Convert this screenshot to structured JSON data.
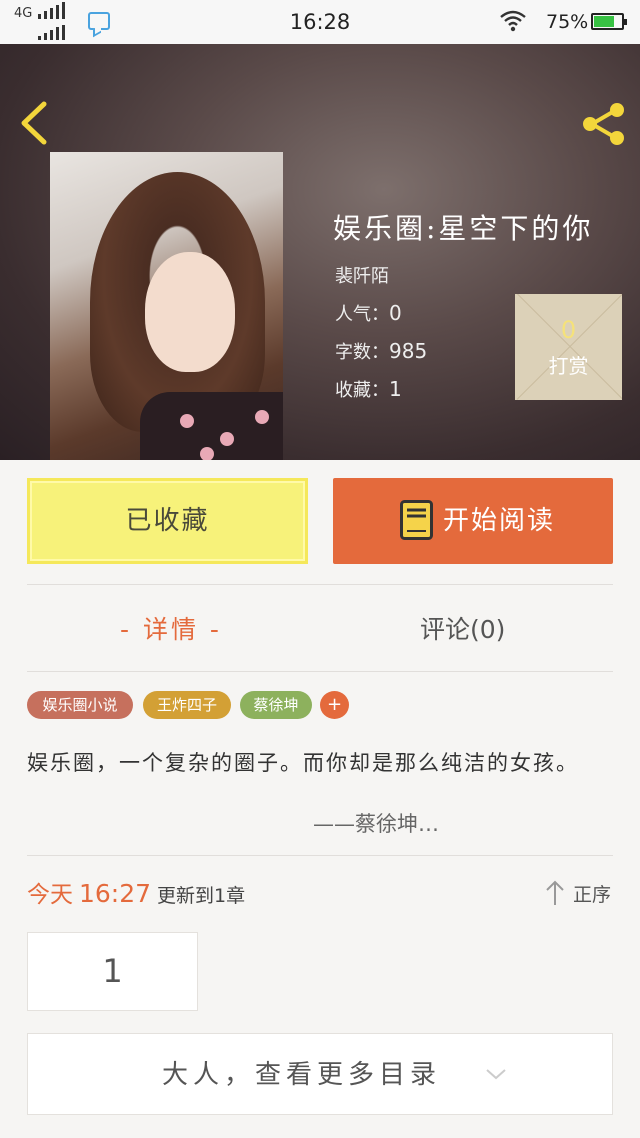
{
  "status_bar": {
    "network": "4G",
    "time": "16:28",
    "battery_percent": "75%",
    "battery_level": 0.75,
    "icons": [
      "signal-icon",
      "call-icon",
      "message-icon",
      "wifi-icon",
      "battery-icon"
    ]
  },
  "header": {
    "back_icon": "chevron-left-icon",
    "share_icon": "share-icon",
    "book_title": "娱乐圈:星空下的你",
    "author": "裴阡陌",
    "stats": {
      "popularity_label": "人气：",
      "popularity_value": "0",
      "words_label": "字数：",
      "words_value": "985",
      "favorites_label": "收藏：",
      "favorites_value": "1"
    },
    "reward": {
      "count": "0",
      "label": "打赏"
    }
  },
  "actions": {
    "favorite_label": "已收藏",
    "read_label": "开始阅读",
    "read_icon": "book-icon"
  },
  "tabs": {
    "detail": "- 详情 -",
    "comments": "评论(0)"
  },
  "tags": [
    {
      "label": "娱乐圈小说",
      "color": "#c6705d"
    },
    {
      "label": "王炸四子",
      "color": "#d3a035"
    },
    {
      "label": "蔡徐坤",
      "color": "#8db15d"
    }
  ],
  "tag_add": "+",
  "intro": {
    "text": "娱乐圈，一个复杂的圈子。而你却是那么纯洁的女孩。",
    "author_line": "——蔡徐坤…"
  },
  "update": {
    "day": "今天",
    "time": "16:27",
    "text": "更新到1章"
  },
  "sort": {
    "label": "正序",
    "icon": "arrow-up-icon"
  },
  "chapter": {
    "number": "1"
  },
  "more": {
    "label": "大人，查看更多目录",
    "icon": "chevron-down-icon"
  },
  "colors": {
    "accent": "#e46a3c",
    "favorite_bg": "#f7f27a",
    "share_icon": "#f3d63b"
  }
}
